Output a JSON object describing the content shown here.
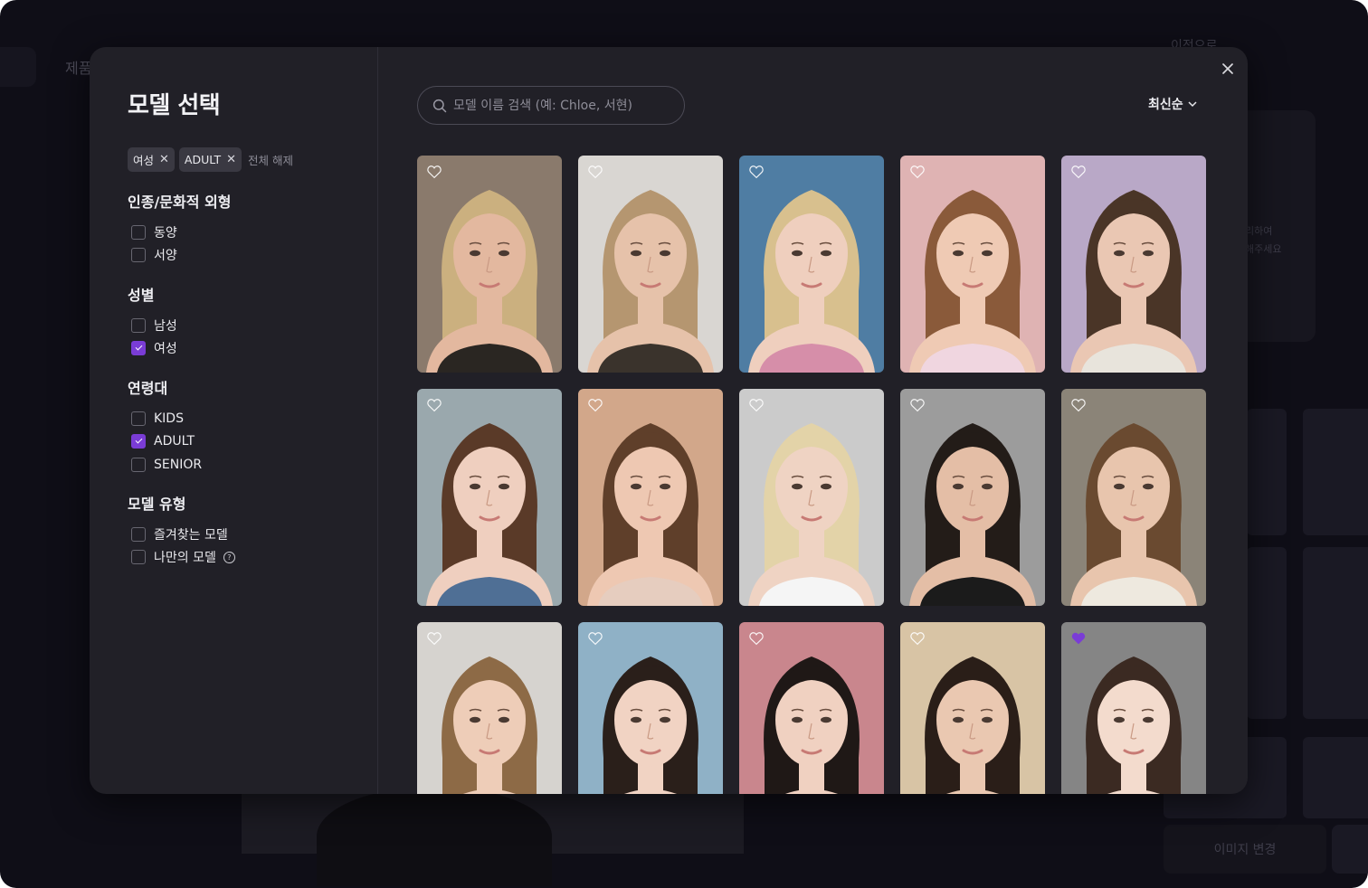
{
  "background": {
    "nav_text": "제품",
    "top_right_text": "이전으로",
    "hint_lines": [
      "리하여",
      "해주세요"
    ],
    "change_image_button": "이미지 변경"
  },
  "modal": {
    "title": "모델 선택",
    "close_icon": "close-icon",
    "chips": [
      {
        "label": "여성",
        "remove": "✕"
      },
      {
        "label": "ADULT",
        "remove": "✕"
      }
    ],
    "clear_all": "전체 해제",
    "filters": [
      {
        "title": "인종/문화적 외형",
        "options": [
          {
            "label": "동양",
            "checked": false
          },
          {
            "label": "서양",
            "checked": false
          }
        ]
      },
      {
        "title": "성별",
        "options": [
          {
            "label": "남성",
            "checked": false
          },
          {
            "label": "여성",
            "checked": true
          }
        ]
      },
      {
        "title": "연령대",
        "options": [
          {
            "label": "KIDS",
            "checked": false
          },
          {
            "label": "ADULT",
            "checked": true
          },
          {
            "label": "SENIOR",
            "checked": false
          }
        ]
      },
      {
        "title": "모델 유형",
        "options": [
          {
            "label": "즐겨찾는 모델",
            "checked": false
          },
          {
            "label": "나만의 모델",
            "checked": false,
            "help": "?"
          }
        ]
      }
    ],
    "search": {
      "placeholder": "모델 이름 검색 (예: Chloe, 서현)",
      "value": ""
    },
    "sort": {
      "label": "최신순",
      "icon": "chevron-down-icon"
    },
    "accent_color": "#7a3cd6",
    "models": [
      {
        "bg": "#8a7a6c",
        "skin": "#e3b89f",
        "hair": "#cbb07f",
        "cloth": "#2a2622",
        "favorite": false
      },
      {
        "bg": "#d9d6d2",
        "skin": "#e6c2aa",
        "hair": "#b59670",
        "cloth": "#3a332c",
        "favorite": false
      },
      {
        "bg": "#4f7da3",
        "skin": "#efcfbe",
        "hair": "#d8c08e",
        "cloth": "#d68ea9",
        "favorite": false
      },
      {
        "bg": "#dfb3b3",
        "skin": "#efcab4",
        "hair": "#8a5a3a",
        "cloth": "#f0d6e0",
        "favorite": false
      },
      {
        "bg": "#b9a8c7",
        "skin": "#eac7b3",
        "hair": "#4a3527",
        "cloth": "#e8e4dc",
        "favorite": false
      },
      {
        "bg": "#9aa8ad",
        "skin": "#efcfbf",
        "hair": "#5a3a28",
        "cloth": "#4f6f95",
        "favorite": false
      },
      {
        "bg": "#d2a78a",
        "skin": "#eec8b2",
        "hair": "#5f3f2a",
        "cloth": "#e6cdbf",
        "favorite": false
      },
      {
        "bg": "#cbcbcb",
        "skin": "#efd3c3",
        "hair": "#e3d3a8",
        "cloth": "#f5f5f5",
        "favorite": false
      },
      {
        "bg": "#9c9c9c",
        "skin": "#e4bea6",
        "hair": "#231c18",
        "cloth": "#1b1b1b",
        "favorite": false
      },
      {
        "bg": "#8b8478",
        "skin": "#e8c5ad",
        "hair": "#6a4a30",
        "cloth": "#eee9df",
        "favorite": false
      },
      {
        "bg": "#d6d3cf",
        "skin": "#eecdb8",
        "hair": "#8d6a46",
        "cloth": "#d9cfc5",
        "favorite": false
      },
      {
        "bg": "#8fb1c6",
        "skin": "#f1d3c3",
        "hair": "#2a1f1a",
        "cloth": "#6d8aa6",
        "favorite": false
      },
      {
        "bg": "#c9868d",
        "skin": "#f0d1c1",
        "hair": "#1f1816",
        "cloth": "#f7f7f7",
        "favorite": false
      },
      {
        "bg": "#d8c4a5",
        "skin": "#eac8b1",
        "hair": "#2a1e18",
        "cloth": "#f0ebe2",
        "favorite": false
      },
      {
        "bg": "#858585",
        "skin": "#f3dbcd",
        "hair": "#3b2a22",
        "cloth": "#f7f7f7",
        "favorite": true
      }
    ]
  }
}
